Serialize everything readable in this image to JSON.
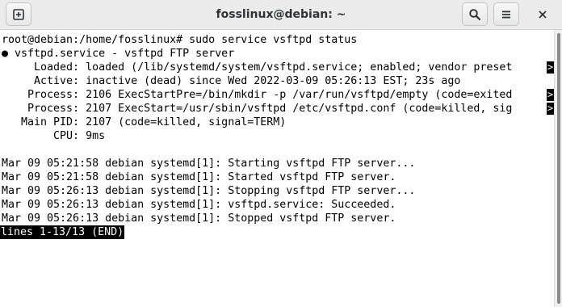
{
  "window": {
    "title": "fosslinux@debian: ~"
  },
  "toolbar": {
    "icons": [
      "new-tab-icon",
      "search-icon",
      "hamburger-menu-icon",
      "close-icon"
    ]
  },
  "terminal": {
    "lines": [
      {
        "text": "root@debian:/home/fosslinux# sudo service vsftpd status",
        "truncated": false
      },
      {
        "text": "● vsftpd.service - vsftpd FTP server",
        "truncated": false
      },
      {
        "text": "     Loaded: loaded (/lib/systemd/system/vsftpd.service; enabled; vendor preset",
        "truncated": true
      },
      {
        "text": "     Active: inactive (dead) since Wed 2022-03-09 05:26:13 EST; 23s ago",
        "truncated": false
      },
      {
        "text": "    Process: 2106 ExecStartPre=/bin/mkdir -p /var/run/vsftpd/empty (code=exited",
        "truncated": true
      },
      {
        "text": "    Process: 2107 ExecStart=/usr/sbin/vsftpd /etc/vsftpd.conf (code=killed, sig",
        "truncated": true
      },
      {
        "text": "   Main PID: 2107 (code=killed, signal=TERM)",
        "truncated": false
      },
      {
        "text": "        CPU: 9ms",
        "truncated": false
      },
      {
        "text": "",
        "truncated": false
      },
      {
        "text": "Mar 09 05:21:58 debian systemd[1]: Starting vsftpd FTP server...",
        "truncated": false
      },
      {
        "text": "Mar 09 05:21:58 debian systemd[1]: Started vsftpd FTP server.",
        "truncated": false
      },
      {
        "text": "Mar 09 05:26:13 debian systemd[1]: Stopping vsftpd FTP server...",
        "truncated": false
      },
      {
        "text": "Mar 09 05:26:13 debian systemd[1]: vsftpd.service: Succeeded.",
        "truncated": false
      },
      {
        "text": "Mar 09 05:26:13 debian systemd[1]: Stopped vsftpd FTP server.",
        "truncated": false
      }
    ],
    "pager_status": "lines 1-13/13 (END)",
    "truncation_marker": ">"
  }
}
